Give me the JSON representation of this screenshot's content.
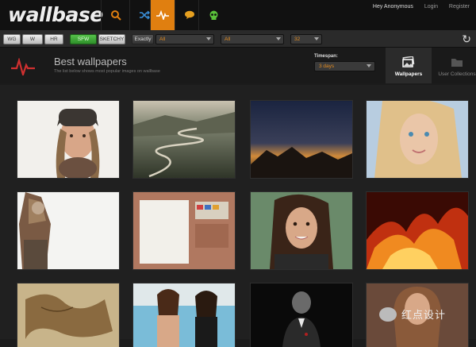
{
  "app": {
    "logo": "wallbase"
  },
  "nav": {
    "icons": [
      "search-icon",
      "shuffle-icon",
      "pulse-icon",
      "chat-icon",
      "skull-icon"
    ],
    "active": "pulse-icon"
  },
  "toplinks": {
    "user": "Hey Anonymous",
    "login": "Login",
    "register": "Register"
  },
  "filters": {
    "wg": "WG",
    "w": "W",
    "hr": "HR",
    "sfw": "SFW",
    "sketchy": "SKETCHY",
    "exactly": "Exactly",
    "resolution": "All",
    "aspect": "All",
    "per_page": "32"
  },
  "header": {
    "title": "Best wallpapers",
    "subtitle": "The list below shows most popular images on wallbase",
    "timespan_label": "Timespan:",
    "timespan_value": "3 days",
    "tab_wallpapers": "Wallpapers",
    "tab_user_collections": "User Collections"
  },
  "colors": {
    "accent": "#e07f10",
    "sfw_green": "#3aa636",
    "background": "#1c1c1c"
  },
  "thumbnails": [
    "woman-beanie",
    "winding-road",
    "mountain-sunset",
    "blonde-woman",
    "armored-warrior",
    "desk-workspace",
    "brunette-woman",
    "fire-art",
    "old-map",
    "women-pool",
    "monkey-suit",
    "woman-portrait"
  ],
  "watermark": {
    "text": "红点设计"
  }
}
